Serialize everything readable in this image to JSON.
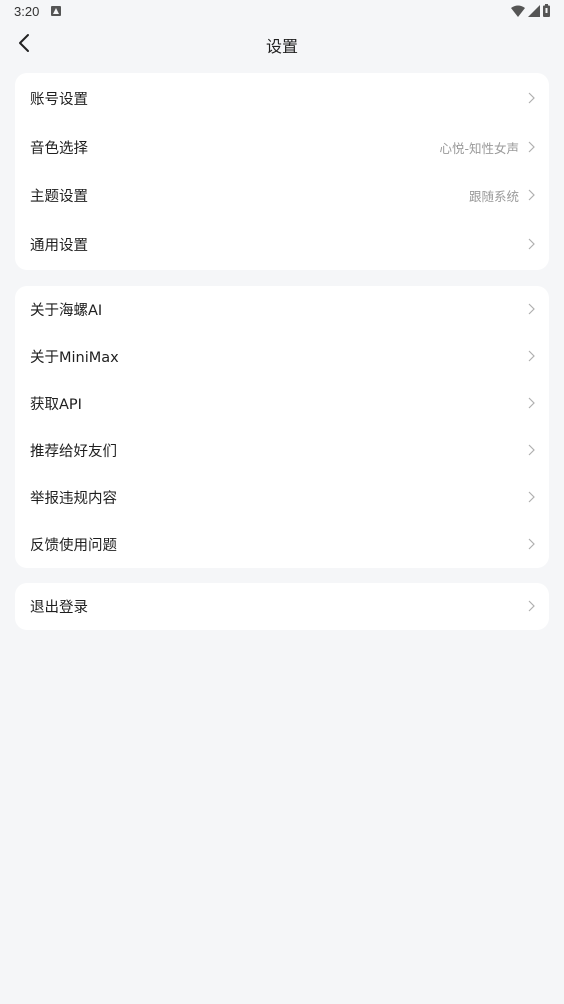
{
  "status": {
    "time": "3:20"
  },
  "header": {
    "title": "设置"
  },
  "groups": [
    {
      "items": [
        {
          "label": "账号设置",
          "value": ""
        },
        {
          "label": "音色选择",
          "value": "心悦-知性女声"
        },
        {
          "label": "主题设置",
          "value": "跟随系统"
        },
        {
          "label": "通用设置",
          "value": ""
        }
      ]
    },
    {
      "items": [
        {
          "label": "关于海螺AI",
          "value": ""
        },
        {
          "label": "关于MiniMax",
          "value": ""
        },
        {
          "label": "获取API",
          "value": ""
        },
        {
          "label": "推荐给好友们",
          "value": ""
        },
        {
          "label": "举报违规内容",
          "value": ""
        },
        {
          "label": "反馈使用问题",
          "value": ""
        }
      ]
    },
    {
      "items": [
        {
          "label": "退出登录",
          "value": ""
        }
      ]
    }
  ],
  "colors": {
    "background": "#f5f6f8",
    "card": "#ffffff",
    "text": "#1f1f1f",
    "secondary": "#9a9a9a",
    "chevron": "#b0b0b0"
  }
}
